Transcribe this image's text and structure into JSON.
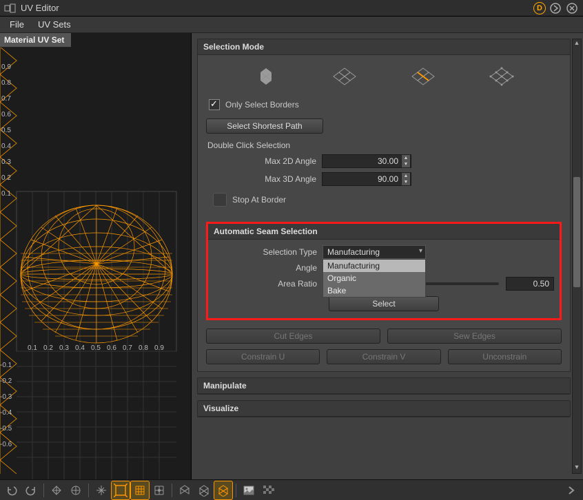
{
  "titlebar": {
    "title": "UV Editor"
  },
  "menubar": {
    "file": "File",
    "uvsets": "UV Sets"
  },
  "left": {
    "tab": "Material UV Set",
    "axis_y": [
      "0.9",
      "0.8",
      "0.7",
      "0.6",
      "0.5",
      "0.4",
      "0.3",
      "0.2",
      "0.1",
      "-0.1",
      "-0.2",
      "-0.3",
      "-0.4",
      "-0.5",
      "-0.6"
    ],
    "axis_x": [
      "0.1",
      "0.2",
      "0.3",
      "0.4",
      "0.5",
      "0.6",
      "0.7",
      "0.8",
      "0.9"
    ]
  },
  "selection_mode": {
    "header": "Selection Mode",
    "only_borders": "Only Select Borders",
    "shortest_path": "Select Shortest Path",
    "double_click_heading": "Double Click Selection",
    "max2d_label": "Max 2D Angle",
    "max2d_value": "30.00",
    "max3d_label": "Max 3D Angle",
    "max3d_value": "90.00",
    "stop_border": "Stop At Border"
  },
  "auto_seam": {
    "header": "Automatic Seam Selection",
    "type_label": "Selection Type",
    "type_value": "Manufacturing",
    "type_options": [
      "Manufacturing",
      "Organic",
      "Bake"
    ],
    "angle_label": "Angle",
    "area_ratio_label": "Area Ratio",
    "area_ratio_value": "0.50",
    "select_btn": "Select"
  },
  "edge_ops": {
    "cut": "Cut Edges",
    "sew": "Sew Edges",
    "cu": "Constrain U",
    "cv": "Constrain V",
    "un": "Unconstrain"
  },
  "collapsed": {
    "manipulate": "Manipulate",
    "visualize": "Visualize"
  }
}
